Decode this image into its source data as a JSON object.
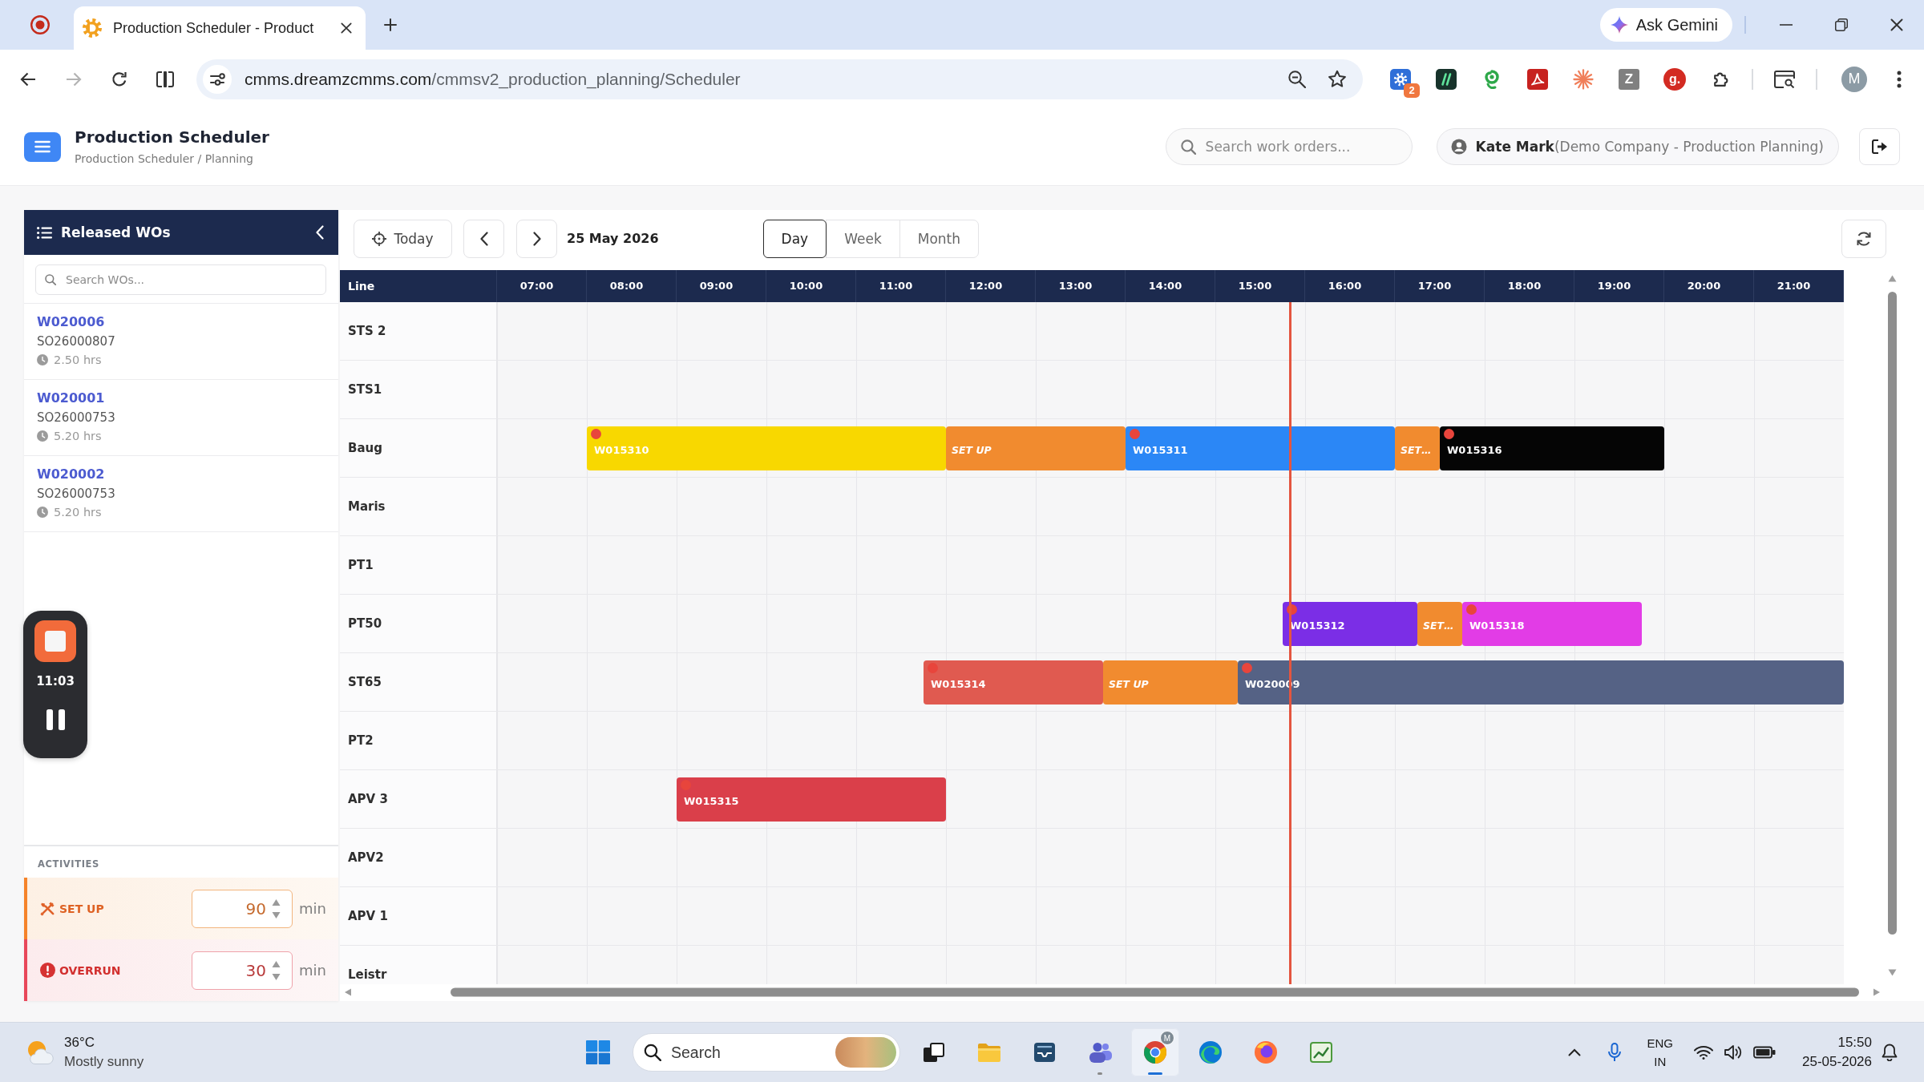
{
  "browser": {
    "tabs": [
      {
        "title": "Production Scheduler - Product",
        "selected": true
      }
    ],
    "ask_gemini": "Ask Gemini",
    "forward_disabled": true,
    "url": {
      "host": "cmms.dreamzcmms.com",
      "path": "/cmmsv2_production_planning/Scheduler"
    },
    "extensions": [
      {
        "kind": "gear",
        "badge": "2"
      },
      {
        "kind": "slashes"
      },
      {
        "kind": "swirl"
      },
      {
        "kind": "pdf"
      },
      {
        "kind": "asterisk"
      },
      {
        "kind": "letter-tile",
        "label": "Z"
      },
      {
        "kind": "letter-disc",
        "label": "g."
      },
      {
        "kind": "puzzle"
      }
    ],
    "profile_initial": "M"
  },
  "app": {
    "title": "Production Scheduler",
    "breadcrumb": "Production Scheduler / Planning",
    "search": {
      "placeholder": "Search work orders..."
    },
    "user": {
      "name": "Kate Mark",
      "company": "(Demo Company - Production Planning)"
    }
  },
  "sidebar": {
    "title": "Released WOs",
    "search": {
      "placeholder": "Search WOs..."
    },
    "items": [
      {
        "wo": "W020006",
        "so": "SO26000807",
        "duration": "2.50 hrs"
      },
      {
        "wo": "W020001",
        "so": "SO26000753",
        "duration": "5.20 hrs"
      },
      {
        "wo": "W020002",
        "so": "SO26000753",
        "duration": "5.20 hrs"
      }
    ]
  },
  "timer": {
    "time": "11:03"
  },
  "activities": {
    "title": "ACTIVITIES",
    "items": [
      {
        "kind": "setup",
        "label": "SET UP",
        "value": "90",
        "unit": "min"
      },
      {
        "kind": "overrun",
        "label": "OVERRUN",
        "value": "30",
        "unit": "min"
      }
    ]
  },
  "toolbar": {
    "today": "Today",
    "date": "25 May 2026",
    "views": [
      {
        "label": "Day",
        "selected": true
      },
      {
        "label": "Week",
        "selected": false
      },
      {
        "label": "Month",
        "selected": false
      }
    ]
  },
  "schedule": {
    "line_header": "Line",
    "hours": [
      "07:00",
      "08:00",
      "09:00",
      "10:00",
      "11:00",
      "12:00",
      "13:00",
      "14:00",
      "15:00",
      "16:00",
      "17:00",
      "18:00",
      "19:00",
      "20:00",
      "21:00"
    ],
    "lines": [
      {
        "name": "STS 2"
      },
      {
        "name": "STS1"
      },
      {
        "name": "Baug",
        "bars": [
          {
            "kind": "order",
            "label": "W015310",
            "color": "#f8d800"
          },
          {
            "kind": "setup",
            "label": "SET UP",
            "color": "#f18b2f"
          },
          {
            "kind": "order",
            "label": "W015311",
            "color": "#2b87f6"
          },
          {
            "kind": "setup",
            "label": "SET…",
            "color": "#f18b2f"
          },
          {
            "kind": "order",
            "label": "W015316",
            "color": "#050505"
          }
        ]
      },
      {
        "name": "Maris"
      },
      {
        "name": "PT1"
      },
      {
        "name": "PT50",
        "bars": [
          {
            "kind": "order",
            "label": "W015312",
            "color": "#7b2ee6"
          },
          {
            "kind": "setup",
            "label": "SET…",
            "color": "#f18b2f"
          },
          {
            "kind": "order",
            "label": "W015318",
            "color": "#e23ce6"
          }
        ]
      },
      {
        "name": "ST65",
        "bars": [
          {
            "kind": "order",
            "label": "W015314",
            "color": "#e05a50"
          },
          {
            "kind": "setup",
            "label": "SET UP",
            "color": "#f18b2f"
          },
          {
            "kind": "order",
            "label": "W020009",
            "color": "#556285"
          }
        ]
      },
      {
        "name": "PT2"
      },
      {
        "name": "APV 3",
        "bars": [
          {
            "kind": "order",
            "label": "W015315",
            "color": "#da3f4a"
          }
        ]
      },
      {
        "name": "APV2"
      },
      {
        "name": "APV 1"
      },
      {
        "name": "Leistr"
      }
    ]
  },
  "taskbar": {
    "weather": {
      "temperature": "36°C",
      "condition": "Mostly sunny"
    },
    "search": {
      "placeholder": "Search"
    },
    "apps": [
      {
        "kind": "task-view",
        "running": false,
        "selected": false
      },
      {
        "kind": "folder",
        "running": false,
        "selected": false
      },
      {
        "kind": "inbox",
        "running": false,
        "selected": false
      },
      {
        "kind": "people",
        "running": true,
        "selected": false
      },
      {
        "kind": "browser",
        "running": true,
        "selected": true,
        "badge": "M"
      },
      {
        "kind": "wave-browser",
        "running": false,
        "selected": false
      },
      {
        "kind": "flame-browser",
        "running": false,
        "selected": false
      },
      {
        "kind": "chart",
        "running": false,
        "selected": false
      }
    ],
    "tray": {
      "language": "ENG",
      "region": "IN"
    },
    "clock": {
      "time": "15:50",
      "date": "25-05-2026"
    }
  }
}
